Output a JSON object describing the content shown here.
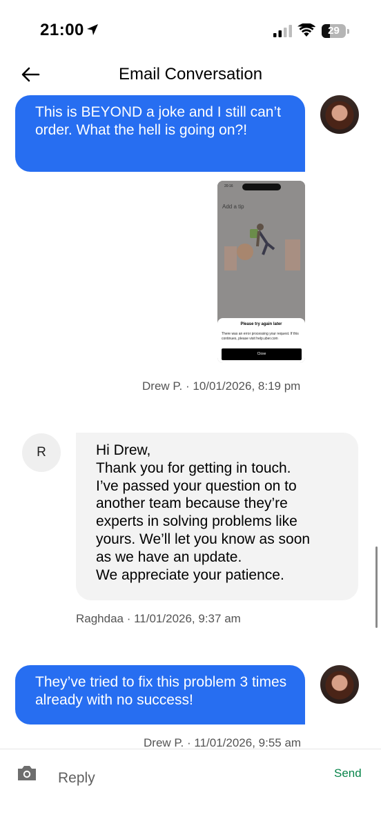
{
  "status": {
    "time": "21:00",
    "battery": "29"
  },
  "header": {
    "title": "Email Conversation"
  },
  "messages": [
    {
      "text": "This is BEYOND a joke and I still can’t order. What the hell is going on?!",
      "meta": "Drew P. · 10/01/2026, 8:19 pm"
    },
    {
      "avatar_letter": "R",
      "lines": [
        "Hi Drew,",
        "Thank you for getting in touch.",
        "I’ve passed your question on to",
        "another team because they’re",
        "experts in solving problems like",
        "yours. We’ll let you know as soon",
        "as we have an update.",
        "We appreciate your patience."
      ],
      "meta": "Raghdaa · 11/01/2026, 9:37 am"
    },
    {
      "text": "They’ve tried to fix this problem 3 times already with no success!",
      "meta": "Drew P. · 11/01/2026, 9:55 am"
    }
  ],
  "attachment": {
    "time": "20:16",
    "title": "Add a tip",
    "sheet_title": "Please try again later",
    "sheet_body": "There was an error processing your request. If this continues, please visit help.uber.com",
    "button": "Close"
  },
  "composer": {
    "placeholder": "Reply",
    "send": "Send"
  },
  "colors": {
    "outgoing_bubble": "#276ef1",
    "incoming_bubble": "#f3f3f3",
    "send": "#07844a"
  }
}
